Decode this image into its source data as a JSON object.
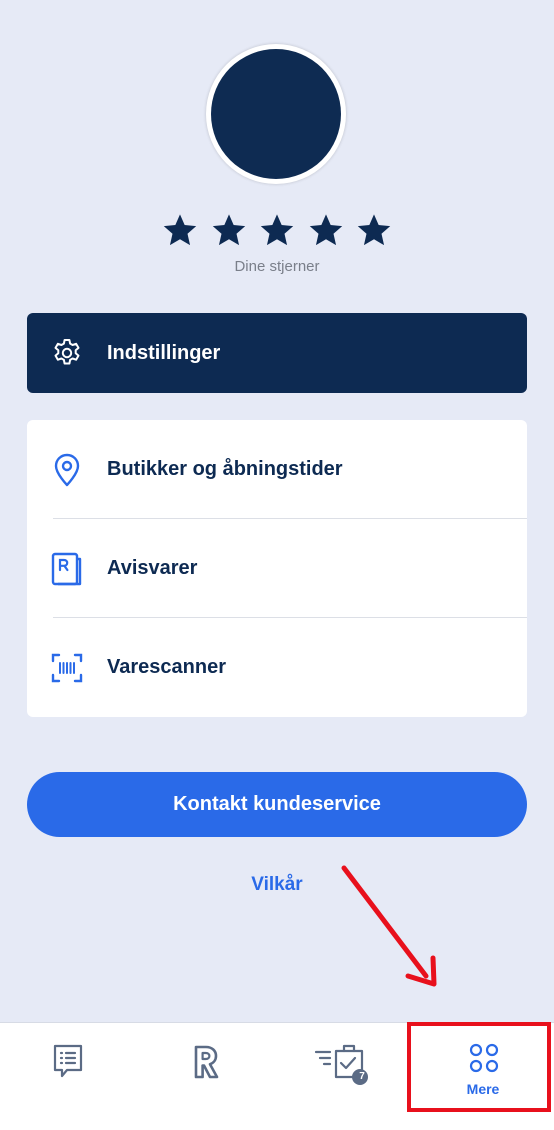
{
  "profile": {
    "stars_count": 5,
    "stars_caption": "Dine stjerner"
  },
  "settings": {
    "label": "Indstillinger"
  },
  "menu": {
    "items": [
      {
        "label": "Butikker og åbningstider",
        "icon": "location-pin-icon"
      },
      {
        "label": "Avisvarer",
        "icon": "newspaper-icon"
      },
      {
        "label": "Varescanner",
        "icon": "barcode-scanner-icon"
      }
    ]
  },
  "contact": {
    "label": "Kontakt kundeservice"
  },
  "terms": {
    "label": "Vilkår"
  },
  "tabbar": {
    "tabs": [
      {
        "icon": "list-icon",
        "label": ""
      },
      {
        "icon": "rema-logo-icon",
        "label": ""
      },
      {
        "icon": "shopping-list-icon",
        "label": "",
        "badge": "7"
      },
      {
        "icon": "more-icon",
        "label": "Mere",
        "active": true
      }
    ]
  },
  "colors": {
    "background": "#e6eaf6",
    "navy": "#0d2a52",
    "accent_blue": "#2a6ae8",
    "annotation_red": "#e8101c"
  }
}
